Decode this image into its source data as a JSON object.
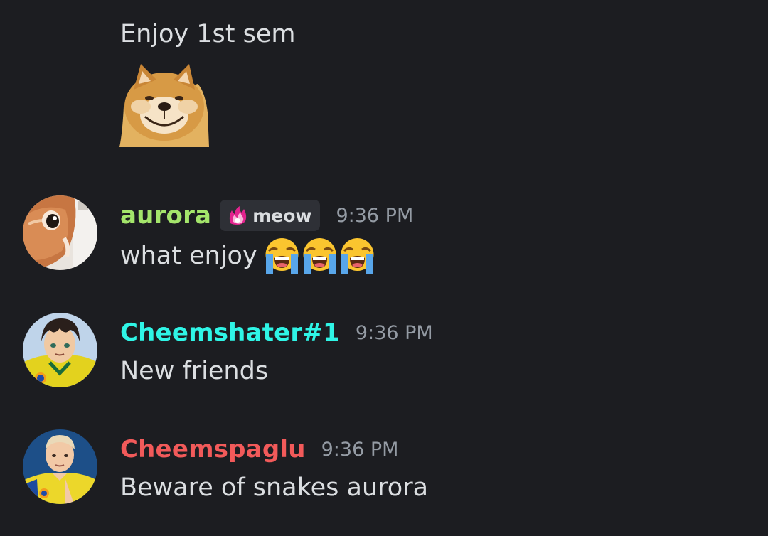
{
  "continued_message": {
    "text": "Enjoy 1st sem",
    "sticker": "cheems-doge-sticker"
  },
  "messages": [
    {
      "username": "aurora",
      "name_color": "#a4e56b",
      "tag": {
        "icon": "pink-flame-icon",
        "label": "meow"
      },
      "time": "9:36 PM",
      "text": "what enjoy",
      "emojis": [
        "loudly-crying-face-icon",
        "loudly-crying-face-icon",
        "loudly-crying-face-icon"
      ],
      "avatar": "orange-cat-avatar"
    },
    {
      "username": "Cheemshater#1",
      "name_color": "#2ff5e6",
      "time": "9:36 PM",
      "text": "New friends",
      "avatar": "anime-character-avatar"
    },
    {
      "username": "Cheemspaglu",
      "name_color": "#f25a5a",
      "time": "9:36 PM",
      "text": "Beware of snakes aurora",
      "avatar": "cricketer-avatar"
    }
  ]
}
